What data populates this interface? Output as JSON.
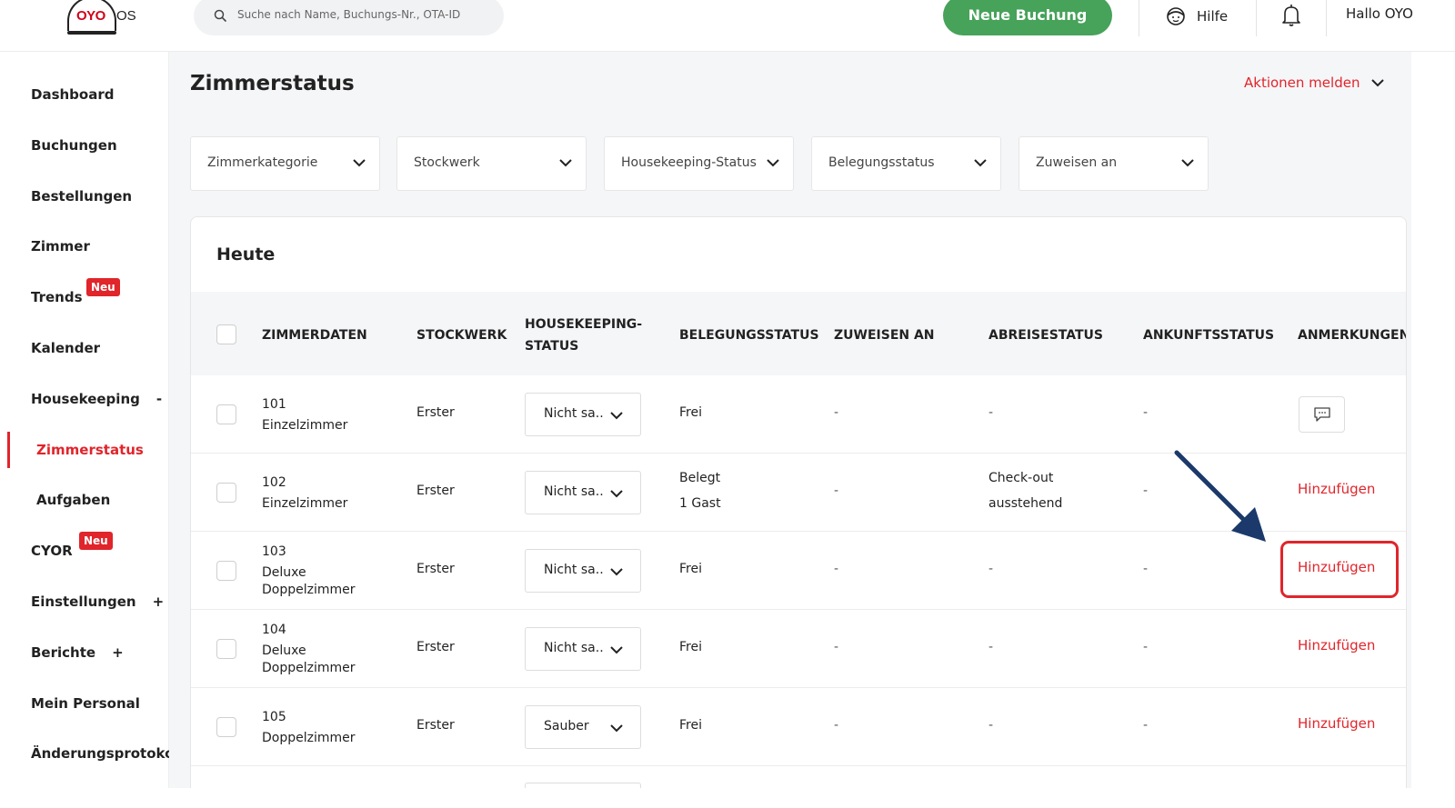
{
  "header": {
    "logo_brand": "OYO",
    "logo_suffix": "OS",
    "search_placeholder": "Suche nach Name, Buchungs-Nr., OTA-ID",
    "new_booking_label": "Neue Buchung",
    "help_label": "Hilfe",
    "greeting": "Hallo OYO"
  },
  "sidebar": {
    "items": [
      {
        "label": "Dashboard"
      },
      {
        "label": "Buchungen"
      },
      {
        "label": "Bestellungen"
      },
      {
        "label": "Zimmer"
      },
      {
        "label": "Trends",
        "badge": "Neu"
      },
      {
        "label": "Kalender"
      },
      {
        "label": "Housekeeping",
        "toggle": "-"
      },
      {
        "label": "Zimmerstatus",
        "active": true
      },
      {
        "label": "Aufgaben"
      },
      {
        "label": "CYOR",
        "badge": "Neu"
      },
      {
        "label": "Einstellungen",
        "toggle": "+"
      },
      {
        "label": "Berichte",
        "toggle": "+"
      },
      {
        "label": "Mein Personal"
      },
      {
        "label": "Änderungsprotokoll"
      }
    ]
  },
  "page": {
    "title": "Zimmerstatus",
    "actions_label": "Aktionen melden"
  },
  "filters": [
    {
      "label": "Zimmerkategorie"
    },
    {
      "label": "Stockwerk"
    },
    {
      "label": "Housekeeping-Status"
    },
    {
      "label": "Belegungsstatus"
    },
    {
      "label": "Zuweisen an"
    }
  ],
  "table": {
    "section_title": "Heute",
    "columns": {
      "room": "ZIMMERDATEN",
      "floor": "STOCKWERK",
      "hk_line1": "HOUSEKEEPING-",
      "hk_line2": "STATUS",
      "occupancy": "BELEGUNGSSTATUS",
      "assign": "ZUWEISEN AN",
      "departure": "ABREISESTATUS",
      "arrival": "ANKUNFTSSTATUS",
      "notes": "ANMERKUNGEN"
    },
    "rows": [
      {
        "number": "101",
        "type_line1": "Einzelzimmer",
        "type_line2": "",
        "floor": "Erster",
        "hk": "Nicht sa..",
        "occ_line1": "Frei",
        "occ_line2": "",
        "assign": "-",
        "dep_line1": "-",
        "dep_line2": "",
        "arr": "-",
        "notes": ""
      },
      {
        "number": "102",
        "type_line1": "Einzelzimmer",
        "type_line2": "",
        "floor": "Erster",
        "hk": "Nicht sa..",
        "occ_line1": "Belegt",
        "occ_line2": "1 Gast",
        "assign": "-",
        "dep_line1": "Check-out",
        "dep_line2": "ausstehend",
        "arr": "-",
        "notes": "Hinzufügen"
      },
      {
        "number": "103",
        "type_line1": "Deluxe",
        "type_line2": "Doppelzimmer",
        "floor": "Erster",
        "hk": "Nicht sa..",
        "occ_line1": "Frei",
        "occ_line2": "",
        "assign": "-",
        "dep_line1": "-",
        "dep_line2": "",
        "arr": "-",
        "notes": "Hinzufügen"
      },
      {
        "number": "104",
        "type_line1": "Deluxe",
        "type_line2": "Doppelzimmer",
        "floor": "Erster",
        "hk": "Nicht sa..",
        "occ_line1": "Frei",
        "occ_line2": "",
        "assign": "-",
        "dep_line1": "-",
        "dep_line2": "",
        "arr": "-",
        "notes": "Hinzufügen"
      },
      {
        "number": "105",
        "type_line1": "Doppelzimmer",
        "type_line2": "",
        "floor": "Erster",
        "hk": "Sauber",
        "occ_line1": "Frei",
        "occ_line2": "",
        "assign": "-",
        "dep_line1": "-",
        "dep_line2": "",
        "arr": "-",
        "notes": "Hinzufügen"
      }
    ]
  },
  "colors": {
    "accent": "#e0252b",
    "primary_button": "#47a25a",
    "arrow": "#1b3a6b"
  },
  "icons": [
    "search-icon",
    "help-face-icon",
    "bell-icon",
    "chevron-down-icon",
    "comment-icon",
    "arrow-pointer-icon"
  ]
}
